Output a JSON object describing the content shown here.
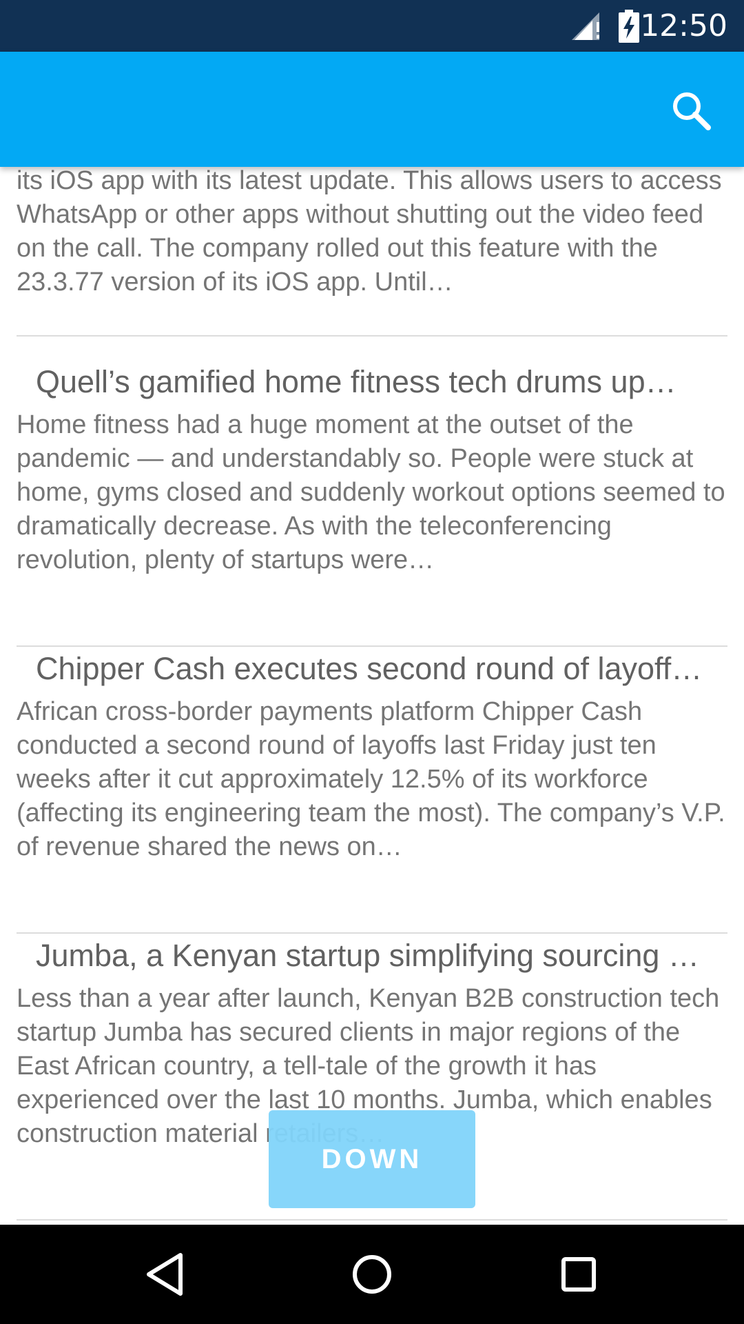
{
  "status_bar": {
    "time": "12:50",
    "icons": [
      "signal-alert-icon",
      "battery-charging-icon"
    ]
  },
  "app_bar": {
    "actions": [
      "search-icon"
    ]
  },
  "articles": [
    {
      "title": "",
      "summary": "its iOS app with its latest update. This allows users to access WhatsApp or other apps without shutting out the video feed on the call. The company rolled out this feature with the 23.3.77 version of its iOS app. Until…"
    },
    {
      "title": "Quell’s gamified home fitness tech drums up…",
      "summary": "Home fitness had a huge moment at the outset of the pandemic — and understandably so. People were stuck at home, gyms closed and suddenly workout options seemed to dramatically decrease. As with the teleconferencing revolution, plenty of startups were…"
    },
    {
      "title": "Chipper Cash executes second round of layoff…",
      "summary": "African cross-border payments platform Chipper Cash conducted a second round of layoffs last Friday just ten weeks after it cut approximately 12.5% of its workforce (affecting its engineering team the most). The company’s V.P. of revenue shared the news on…"
    },
    {
      "title": "Jumba, a Kenyan startup simplifying sourcing …",
      "summary": "Less than a year after launch, Kenyan B2B construction tech startup Jumba has secured clients in major regions of the East African country, a tell-tale of the growth it has experienced over the last 10 months. Jumba, which enables construction material retailers…"
    }
  ],
  "down_button": {
    "label": "DOWN"
  },
  "nav_bar": {
    "items": [
      "back-icon",
      "home-icon",
      "recents-icon"
    ]
  }
}
